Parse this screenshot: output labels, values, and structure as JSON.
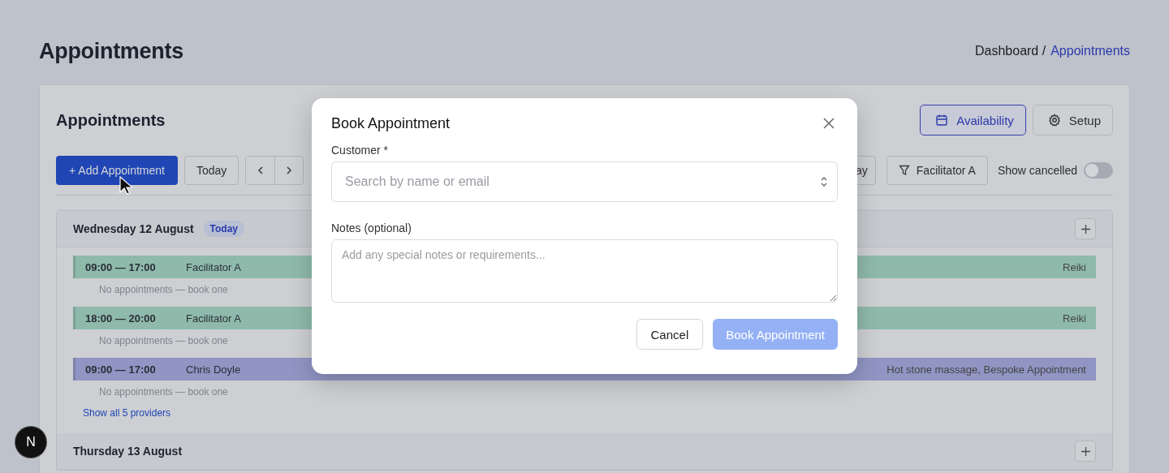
{
  "page": {
    "title": "Appointments"
  },
  "breadcrumb": [
    {
      "label": "Dashboard /",
      "selected": false
    },
    {
      "label": "Appointments",
      "selected": true
    }
  ],
  "card": {
    "title": "Appointments",
    "header_buttons": [
      {
        "label": "Availability",
        "selected": true
      },
      {
        "label": "Setup",
        "selected": false
      }
    ]
  },
  "toolbar": {
    "add_button": "+ Add Appointment",
    "today_button": "Today",
    "view_button": "ay",
    "filter_button": "Facilitator A",
    "show_cancelled": {
      "label": "Show cancelled",
      "on": false
    }
  },
  "days": [
    {
      "title": "Wednesday 12 August",
      "badge": "Today",
      "show_all": "Show all 5 providers",
      "slots": [
        {
          "time": "09:00 — 17:00",
          "provider": "Facilitator A",
          "services": "Reiki",
          "note": "No appointments — book one",
          "color": "#8fbaab"
        },
        {
          "time": "18:00 — 20:00",
          "provider": "Facilitator A",
          "services": "Reiki",
          "note": "No appointments — book one",
          "color": "#8fbaab"
        },
        {
          "time": "09:00 — 17:00",
          "provider": "Chris Doyle",
          "services": "Hot stone massage, Bespoke Appointment",
          "note": "No appointments — book one",
          "color": "#9095c3"
        }
      ]
    },
    {
      "title": "Thursday 13 August"
    }
  ],
  "modal": {
    "title": "Book Appointment",
    "customer_label": "Customer *",
    "customer_placeholder": "Search by name or email",
    "notes_label": "Notes (optional)",
    "notes_placeholder": "Add any special notes or requirements...",
    "cancel_button": "Cancel",
    "submit_button": {
      "label": "Book Appointment",
      "disabled": true
    }
  },
  "dev_badge": "N"
}
